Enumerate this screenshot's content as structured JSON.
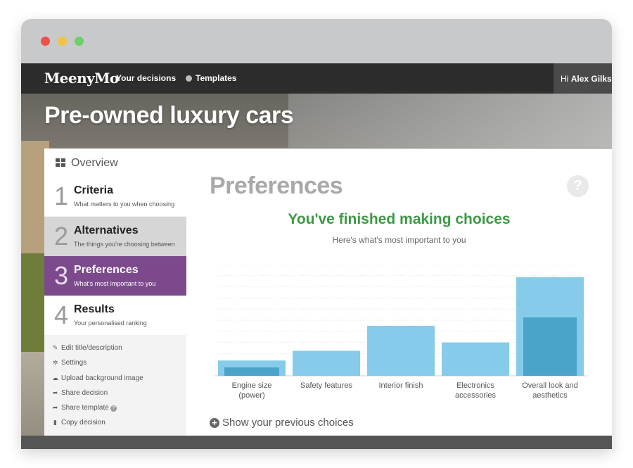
{
  "window": {
    "traffic_lights": [
      "close",
      "minimize",
      "maximize"
    ]
  },
  "nav": {
    "logo": "MeenyMo",
    "your_decisions": "Your decisions",
    "templates": "Templates",
    "greeting_prefix": "Hi",
    "user_name": "Alex Gilks"
  },
  "page_title": "Pre-owned luxury cars",
  "sidebar": {
    "overview": "Overview",
    "steps": [
      {
        "num": "1",
        "title": "Criteria",
        "subtitle": "What matters to you when choosing"
      },
      {
        "num": "2",
        "title": "Alternatives",
        "subtitle": "The things you're choosing between"
      },
      {
        "num": "3",
        "title": "Preferences",
        "subtitle": "What's most important to you"
      },
      {
        "num": "4",
        "title": "Results",
        "subtitle": "Your personalised ranking"
      }
    ],
    "actions": [
      {
        "icon": "pencil-icon",
        "label": "Edit title/description"
      },
      {
        "icon": "gear-icon",
        "label": "Settings"
      },
      {
        "icon": "cloud-upload-icon",
        "label": "Upload background image"
      },
      {
        "icon": "share-icon",
        "label": "Share decision"
      },
      {
        "icon": "share-icon",
        "label": "Share template"
      },
      {
        "icon": "document-icon",
        "label": "Copy decision"
      }
    ]
  },
  "content": {
    "heading": "Preferences",
    "help_symbol": "?",
    "finished": "You've finished making choices",
    "subheading": "Here's what's most important to you",
    "show_previous": "Show your previous choices"
  },
  "colors": {
    "bar_light": "#86cbe9",
    "bar_dark": "#4aa3c8",
    "purple": "#7c4a8c",
    "green": "#3c9a44"
  },
  "chart_data": {
    "type": "bar",
    "categories": [
      "Engine size (power)",
      "Safety features",
      "Interior finish",
      "Electronics accessories",
      "Overall look and aesthetics"
    ],
    "series": [
      {
        "values": [
          11,
          18,
          36,
          24,
          71
        ]
      },
      {
        "values": [
          6,
          0,
          0,
          0,
          42
        ]
      }
    ],
    "ylim": [
      0,
      80
    ],
    "grid": true,
    "title": "",
    "xlabel": "",
    "ylabel": ""
  }
}
